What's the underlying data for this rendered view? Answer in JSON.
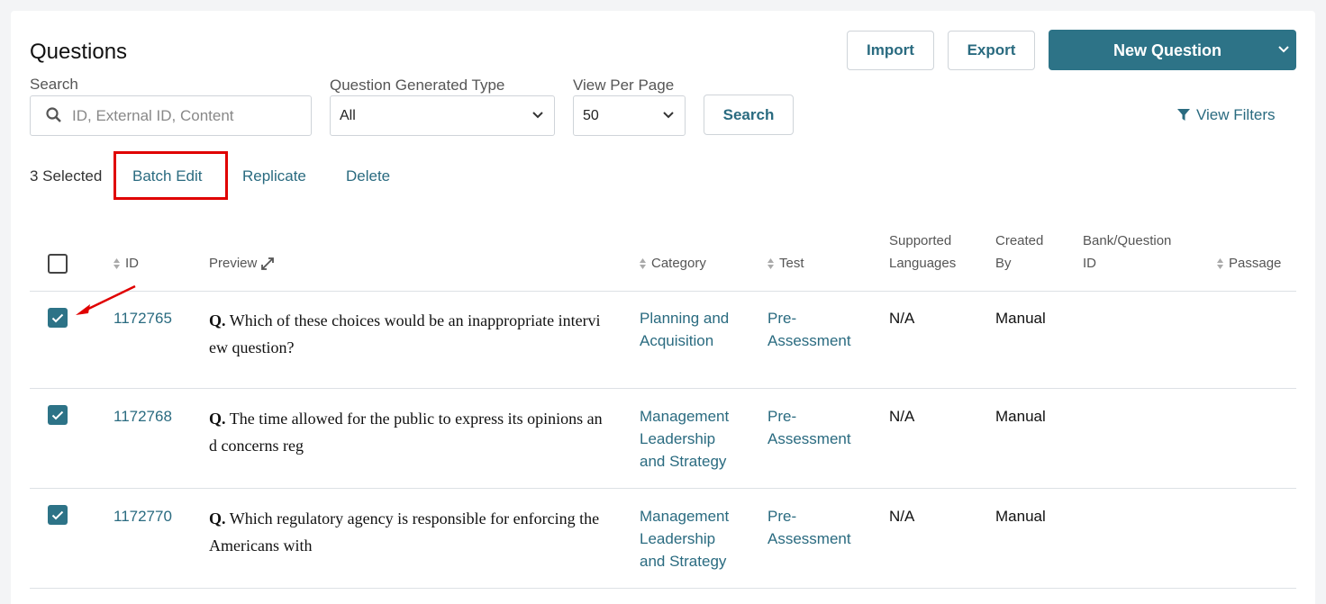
{
  "page": {
    "title": "Questions"
  },
  "header_buttons": {
    "import": "Import",
    "export": "Export",
    "new_question": "New Question"
  },
  "filters": {
    "search_label": "Search",
    "search_placeholder": "ID, External ID, Content",
    "type_label": "Question Generated Type",
    "type_value": "All",
    "per_page_label": "View Per Page",
    "per_page_value": "50",
    "search_button": "Search",
    "view_filters": "View Filters"
  },
  "selection": {
    "count_text": "3 Selected",
    "batch_edit": "Batch Edit",
    "replicate": "Replicate",
    "delete": "Delete"
  },
  "columns": {
    "id": "ID",
    "preview": "Preview",
    "category": "Category",
    "test": "Test",
    "supported_languages": [
      "Supported",
      "Languages"
    ],
    "created_by": [
      "Created",
      "By"
    ],
    "bank_question_id": [
      "Bank/Question",
      "ID"
    ],
    "passage": "Passage"
  },
  "rows": [
    {
      "checked": true,
      "id": "1172765",
      "q_prefix": "Q.",
      "q_text": "Which of these choices would be an inappropriate interview question?",
      "category": [
        "Planning and",
        "Acquisition"
      ],
      "test": [
        "Pre-",
        "Assessment"
      ],
      "languages": "N/A",
      "created_by": "Manual"
    },
    {
      "checked": true,
      "id": "1172768",
      "q_prefix": "Q.",
      "q_text": "The time allowed for the public to express its opinions and concerns reg",
      "category": [
        "Management",
        "Leadership",
        "and Strategy"
      ],
      "test": [
        "Pre-",
        "Assessment"
      ],
      "languages": "N/A",
      "created_by": "Manual"
    },
    {
      "checked": true,
      "id": "1172770",
      "q_prefix": "Q.",
      "q_text": "Which regulatory agency is responsible for enforcing the Americans with",
      "category": [
        "Management",
        "Leadership",
        "and Strategy"
      ],
      "test": [
        "Pre-",
        "Assessment"
      ],
      "languages": "N/A",
      "created_by": "Manual"
    }
  ],
  "colors": {
    "accent": "#2d7387",
    "link": "#2a6b80",
    "highlight": "#e00000"
  }
}
